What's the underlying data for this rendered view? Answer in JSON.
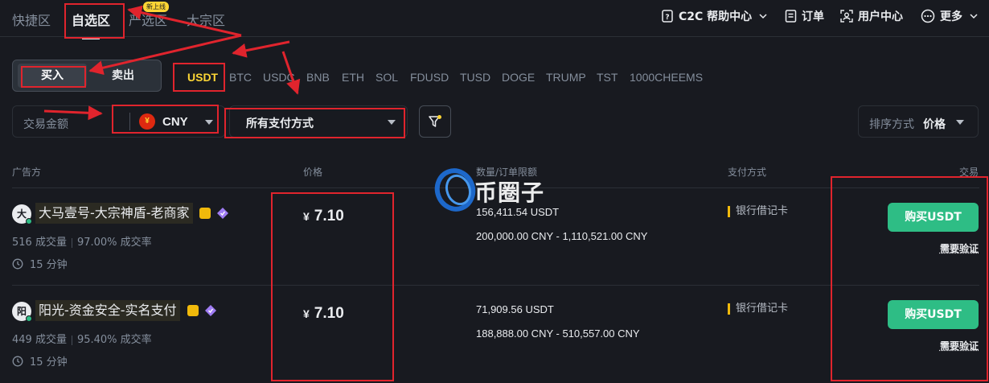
{
  "nav": {
    "zones": [
      {
        "label": "快捷区"
      },
      {
        "label": "自选区"
      },
      {
        "label": "严选区"
      },
      {
        "label": "大宗区"
      }
    ],
    "new_badge": "新上线",
    "right": {
      "help": "C2C 帮助中心",
      "orders": "订单",
      "user_center": "用户中心",
      "more": "更多"
    }
  },
  "trade_toggle": {
    "buy": "买入",
    "sell": "卖出"
  },
  "coins": [
    "USDT",
    "BTC",
    "USDC",
    "BNB",
    "ETH",
    "SOL",
    "FDUSD",
    "TUSD",
    "DOGE",
    "TRUMP",
    "TST",
    "1000CHEEMS"
  ],
  "filters": {
    "amount_placeholder": "交易金额",
    "currency": "CNY",
    "currency_symbol": "¥",
    "payment_method": "所有支付方式",
    "sort_label": "排序方式",
    "sort_value": "价格"
  },
  "table": {
    "headers": {
      "advertiser": "广告方",
      "price": "价格",
      "limits": "数量/订单限额",
      "payment": "支付方式",
      "trade": "交易"
    },
    "rows": [
      {
        "avatar": "大",
        "name": "大马壹号-大宗神盾-老商家",
        "orders": "516 成交量",
        "completion": "97.00% 成交率",
        "time": "15 分钟",
        "price_currency": "¥",
        "price": "7.10",
        "available": "156,411.54 USDT",
        "limit": "200,000.00 CNY - 1,110,521.00 CNY",
        "payment": "银行借记卡",
        "action": "购买USDT",
        "verify": "需要验证"
      },
      {
        "avatar": "阳",
        "name": "阳光-资金安全-实名支付",
        "orders": "449 成交量",
        "completion": "95.40% 成交率",
        "time": "15 分钟",
        "price_currency": "¥",
        "price": "7.10",
        "available": "71,909.56 USDT",
        "limit": "188,888.00 CNY - 510,557.00 CNY",
        "payment": "银行借记卡",
        "action": "购买USDT",
        "verify": "需要验证"
      }
    ]
  },
  "watermark": "币圈子",
  "colors": {
    "background": "#181a20",
    "accent_yellow": "#fcd535",
    "buy_green": "#2ebd85",
    "annotation_red": "#e0242d"
  }
}
